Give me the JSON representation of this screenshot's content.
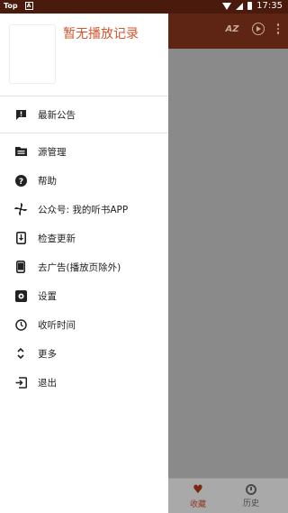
{
  "status_bar": {
    "left_label": "Top",
    "left_badge": "A",
    "time": "17:35"
  },
  "app_bar": {
    "sort_label": "AZ"
  },
  "drawer": {
    "title": "暂无播放记录",
    "announcement": "最新公告",
    "items": [
      {
        "label": "源管理",
        "icon": "folder-icon"
      },
      {
        "label": "帮助",
        "icon": "help-icon"
      },
      {
        "label": "公众号: 我的听书APP",
        "icon": "pinwheel-icon"
      },
      {
        "label": "检查更新",
        "icon": "update-icon"
      },
      {
        "label": "去广告(播放页除外)",
        "icon": "phone-icon"
      },
      {
        "label": "设置",
        "icon": "settings-icon"
      },
      {
        "label": "收听时间",
        "icon": "timer-icon"
      },
      {
        "label": "更多",
        "icon": "expand-icon"
      },
      {
        "label": "退出",
        "icon": "exit-icon"
      }
    ]
  },
  "bottom_nav": {
    "favorites": "收藏",
    "history": "历史"
  },
  "colors": {
    "accent": "#d4552e",
    "app_bar": "#5e2414",
    "status_bar": "#4a1b0c"
  }
}
